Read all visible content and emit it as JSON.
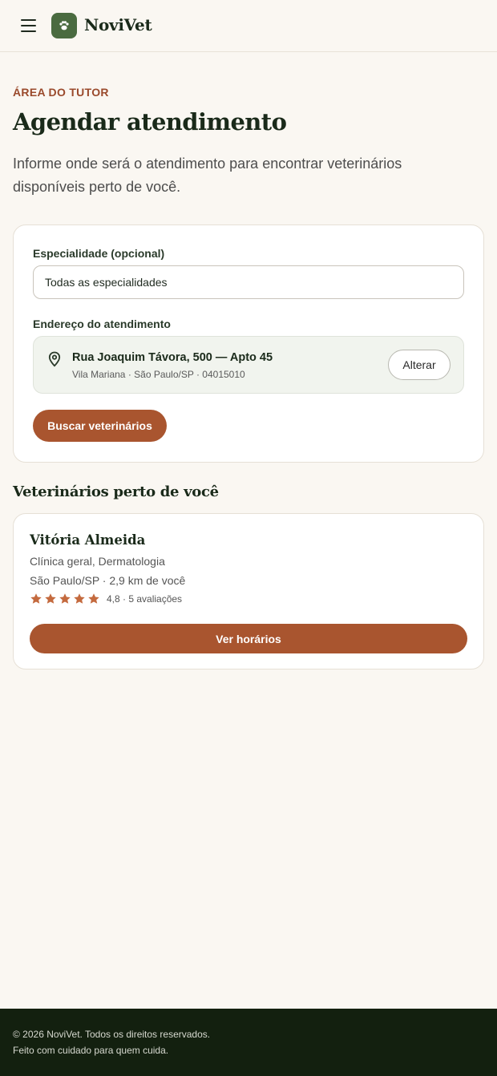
{
  "header": {
    "brand": "NoviVet",
    "menu_icon": "hamburger-menu-icon",
    "logo_icon": "paw-icon"
  },
  "intro": {
    "eyebrow": "ÁREA DO TUTOR",
    "title": "Agendar atendimento",
    "description": "Informe onde será o atendimento para encontrar veterinários disponíveis perto de você."
  },
  "search": {
    "specialty_label": "Especialidade (opcional)",
    "specialty_value": "Todas as especialidades",
    "address_label": "Endereço do atendimento",
    "address_line1": "Rua Joaquim Távora, 500 — Apto 45",
    "address_line2": "Vila Mariana · São Paulo/SP · 04015010",
    "change_label": "Alterar",
    "submit_label": "Buscar veterinários"
  },
  "results": {
    "title": "Veterinários perto de você",
    "vets": [
      {
        "name": "Vitória Almeida",
        "specialties": "Clínica geral, Dermatologia",
        "location": "São Paulo/SP · 2,9 km de você",
        "stars": 5,
        "rating_text": "4,8 · 5 avaliações",
        "action_label": "Ver horários"
      }
    ]
  },
  "footer": {
    "line1": "© 2026 NoviVet. Todos os direitos reservados.",
    "line2": "Feito com cuidado para quem cuida."
  },
  "colors": {
    "background": "#faf7f2",
    "brand_green": "#4a6b40",
    "accent": "#a9552f",
    "eyebrow": "#9a4a2c",
    "footer_bg": "#13200f"
  }
}
